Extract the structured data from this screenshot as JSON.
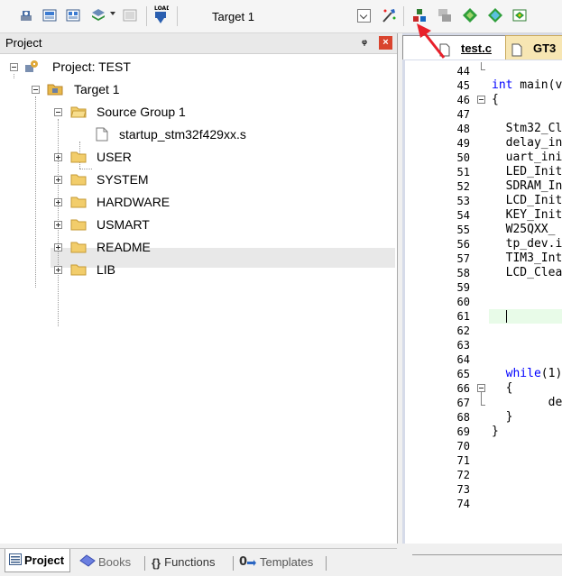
{
  "toolbar": {
    "target_value": "Target 1",
    "icons": [
      "translate-icon",
      "build-icon",
      "rebuild-icon",
      "batch-build-icon",
      "stop-build-icon",
      "download-icon",
      "options-icon",
      "manage-components-icon",
      "run-time-env-icon",
      "pack-installer-icon",
      "select-packs-icon",
      "ide-icon"
    ]
  },
  "project_panel": {
    "title": "Project",
    "tree": {
      "root": "Project: TEST",
      "target": "Target 1",
      "source_group": "Source Group 1",
      "file": "startup_stm32f429xx.s",
      "groups": [
        "USER",
        "SYSTEM",
        "HARDWARE",
        "USMART",
        "README",
        "LIB"
      ]
    },
    "bottom_tabs": [
      "Project",
      "Books",
      "Functions",
      "Templates"
    ]
  },
  "editor": {
    "tabs": [
      "test.c",
      "GT3"
    ],
    "line_numbers": [
      "44",
      "45",
      "46",
      "47",
      "48",
      "49",
      "50",
      "51",
      "52",
      "53",
      "54",
      "55",
      "56",
      "57",
      "58",
      "59",
      "60",
      "61",
      "62",
      "63",
      "64",
      "65",
      "66",
      "67",
      "68",
      "69",
      "70",
      "71",
      "72",
      "73",
      "74"
    ],
    "lines": {
      "l45_kw": "int",
      "l45_rest": " main(v",
      "l46": "{",
      "l48": "  Stm32_Cl",
      "l49": "  delay_in",
      "l50": "  uart_ini",
      "l51": "  LED_Init",
      "l52": "  SDRAM_In",
      "l53": "  LCD_Init",
      "l54": "  KEY_Init",
      "l55": "  W25QXX_",
      "l56": "  tp_dev.i",
      "l57": "  TIM3_Int",
      "l58": "  LCD_Clea",
      "l65_kw": "while",
      "l65_rest": "(1)",
      "l66": "  {",
      "l67": "        de",
      "l68": "  }",
      "l69": "}"
    }
  },
  "colors": {
    "keyword": "#0000ff",
    "annotation_arrow": "#e8202a",
    "close_button": "#d9442e"
  }
}
